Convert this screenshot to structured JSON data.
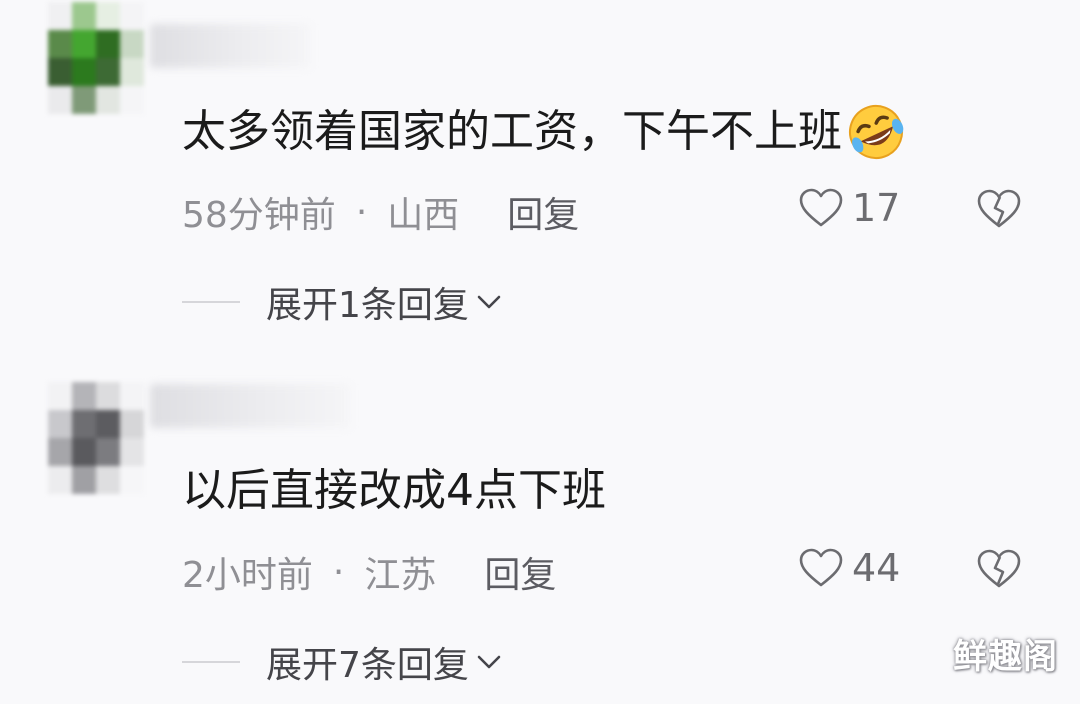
{
  "comments": [
    {
      "text": "太多领着国家的工资，下午不上班",
      "emoji": "rolling-on-floor-laughing-emoji",
      "time": "58分钟前",
      "separator": "·",
      "location": "山西",
      "reply_label": "回复",
      "likes": "17",
      "expand_label": "展开1条回复"
    },
    {
      "text": "以后直接改成4点下班",
      "time": "2小时前",
      "separator": "·",
      "location": "江苏",
      "reply_label": "回复",
      "likes": "44",
      "expand_label": "展开7条回复"
    }
  ],
  "watermark": "鲜趣阁",
  "colors": {
    "background": "#f9f9fb",
    "text": "#1b1b1b",
    "meta": "#8f8f94",
    "icon": "#6c6c70"
  }
}
